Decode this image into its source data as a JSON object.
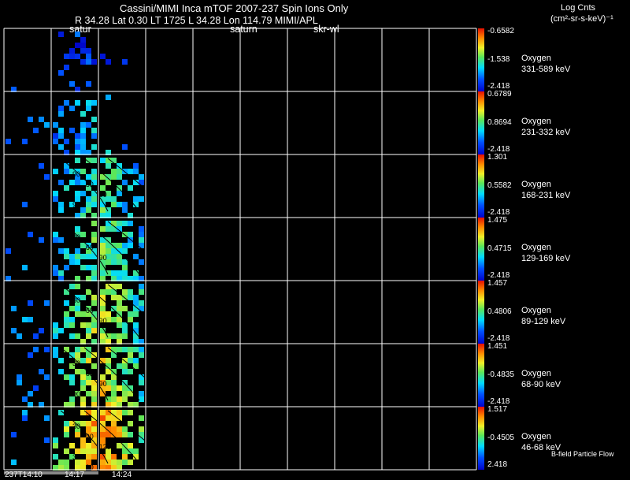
{
  "header": {
    "title": "Cassini/MIMI Inca mTOF  2007-237   Spin   Ions Only",
    "subtitle": "R        34.28 Lat 0.30 LT 1725 L           34.28 Lon           114.79  MIMI/APL",
    "units_line1": "Log Cnts",
    "units_line2": "(cm²-sr-s-keV)⁻¹"
  },
  "panel_labels": [
    "satur",
    "saturn",
    "skr-wl"
  ],
  "time_labels": [
    "237T14:10",
    "14:17",
    "14:24"
  ],
  "flow_label": "B-field Particle Flow",
  "colors": {
    "background": "#000000",
    "grid": "#ffffff",
    "contour": "#000000"
  },
  "chart_data": {
    "type": "heatmap",
    "colormap": "rainbow (blue→cyan→green→yellow→red)",
    "grid": true,
    "columns": 10,
    "x_tick_labels": [
      "237T14:10",
      "14:17",
      "14:24"
    ],
    "rows": [
      {
        "species": "Oxygen",
        "energy": "331-589 keV",
        "cbar_max": "-0.6582",
        "cbar_mid": "-1.538",
        "cbar_min": "-2.418",
        "level": 0.15,
        "contours": []
      },
      {
        "species": "Oxygen",
        "energy": "231-332 keV",
        "cbar_max": "0.6789",
        "cbar_mid": "0.8694",
        "cbar_min": "-2.418",
        "level": 0.35,
        "contours": []
      },
      {
        "species": "Oxygen",
        "energy": "168-231 keV",
        "cbar_max": "1.301",
        "cbar_mid": "0.5582",
        "cbar_min": "-2.418",
        "level": 0.45,
        "contours": [
          "90",
          "30",
          "60",
          "90"
        ]
      },
      {
        "species": "Oxygen",
        "energy": "129-169 keV",
        "cbar_max": "1.475",
        "cbar_mid": "0.4715",
        "cbar_min": "-2.418",
        "level": 0.5,
        "contours": [
          "90",
          "60",
          "90"
        ]
      },
      {
        "species": "Oxygen",
        "energy": "89-129 keV",
        "cbar_max": "1.457",
        "cbar_mid": "0.4806",
        "cbar_min": "-2.418",
        "level": 0.6,
        "contours": [
          "30",
          "60",
          "90",
          "90"
        ]
      },
      {
        "species": "Oxygen",
        "energy": "68-90 keV",
        "cbar_max": "1.451",
        "cbar_mid": "-0.4835",
        "cbar_min": "-2.418",
        "level": 0.65,
        "contours": [
          "30",
          "60",
          "90",
          "90"
        ]
      },
      {
        "species": "Oxygen",
        "energy": "46-68 keV",
        "cbar_max": "1.517",
        "cbar_mid": "-0.4505",
        "cbar_min": "2.418",
        "level": 0.78,
        "contours": [
          "30",
          "90",
          "120",
          "30",
          "90"
        ]
      }
    ]
  }
}
